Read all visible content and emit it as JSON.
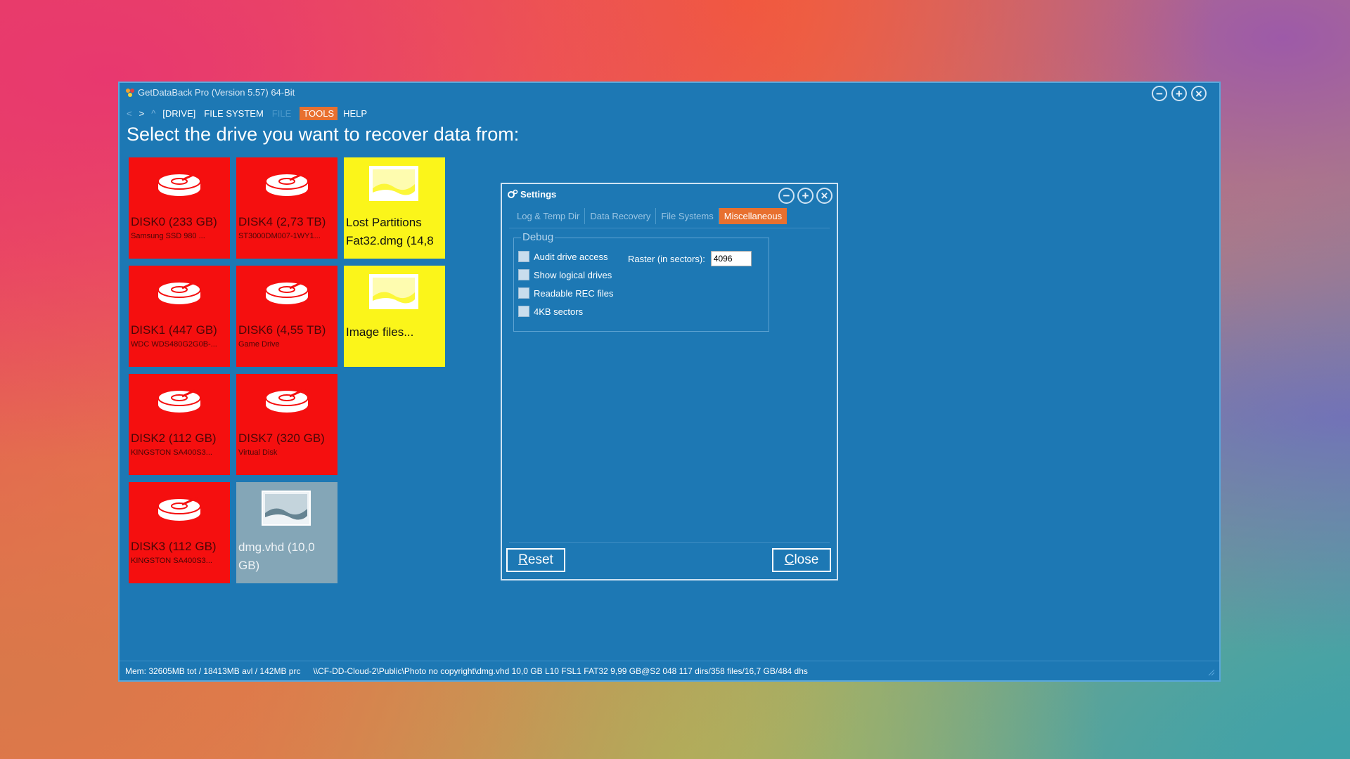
{
  "window": {
    "title": "GetDataBack Pro (Version 5.57) 64-Bit",
    "controls": [
      "−",
      "+",
      "×"
    ]
  },
  "menu": {
    "back": "<",
    "forward": ">",
    "up": "^",
    "items": [
      {
        "label": "[DRIVE]",
        "state": "normal"
      },
      {
        "label": "FILE SYSTEM",
        "state": "normal"
      },
      {
        "label": "FILE",
        "state": "disabled"
      },
      {
        "label": "TOOLS",
        "state": "active"
      },
      {
        "label": "HELP",
        "state": "normal"
      }
    ]
  },
  "heading": "Select the drive you want to recover data from:",
  "tiles": [
    {
      "name": "DISK0 (233 GB)",
      "sub": "Samsung SSD 980 ...",
      "kind": "disk",
      "color": "#f50f0f"
    },
    {
      "name": "DISK4 (2,73 TB)",
      "sub": "ST3000DM007-1WY1...",
      "kind": "disk",
      "color": "#f50f0f"
    },
    {
      "name": "Lost Partitions Fat32.dmg (14,8",
      "sub": "",
      "kind": "image",
      "color": "#fbf51a"
    },
    {
      "name": "DISK1 (447 GB)",
      "sub": "WDC WDS480G2G0B-...",
      "kind": "disk",
      "color": "#f50f0f"
    },
    {
      "name": "DISK6 (4,55 TB)",
      "sub": "Game Drive",
      "kind": "disk",
      "color": "#f50f0f"
    },
    {
      "name": "Image files...",
      "sub": "",
      "kind": "image",
      "color": "#fbf51a"
    },
    {
      "name": "DISK2 (112 GB)",
      "sub": "KINGSTON SA400S3...",
      "kind": "disk",
      "color": "#f50f0f"
    },
    {
      "name": "DISK7 (320 GB)",
      "sub": "Virtual Disk",
      "kind": "disk",
      "color": "#f50f0f"
    },
    {
      "name": "DISK3 (112 GB)",
      "sub": "KINGSTON SA400S3...",
      "kind": "disk",
      "color": "#f50f0f"
    },
    {
      "name": "dmg.vhd (10,0 GB)",
      "sub": "",
      "kind": "image",
      "color": "#84a6b7"
    }
  ],
  "statusbar": {
    "mem": "Mem: 32605MB tot / 18413MB avl / 142MB prc",
    "path": "\\\\CF-DD-Cloud-2\\Public\\Photo no copyright\\dmg.vhd 10,0 GB L10 FSL1 FAT32 9,99 GB@S2 048 117 dirs/358 files/16,7 GB/484 dhs"
  },
  "settings": {
    "title": "Settings",
    "tabs": [
      "Log & Temp Dir",
      "Data Recovery",
      "File Systems",
      "Miscellaneous"
    ],
    "active_tab": "Miscellaneous",
    "group": "Debug",
    "checkboxes": [
      {
        "label": "Audit drive access",
        "checked": false
      },
      {
        "label": "Show logical drives",
        "checked": false
      },
      {
        "label": "Readable REC files",
        "checked": false
      },
      {
        "label": "4KB sectors",
        "checked": false
      }
    ],
    "raster_label": "Raster (in sectors):",
    "raster_value": "4096",
    "reset_accel": "R",
    "reset_rest": "eset",
    "close_accel": "C",
    "close_rest": "lose"
  },
  "colors": {
    "window_bg": "#1d78b4",
    "accent": "#e8702f",
    "disk_tile": "#f50f0f",
    "image_tile": "#fbf51a",
    "vhd_tile": "#84a6b7"
  }
}
